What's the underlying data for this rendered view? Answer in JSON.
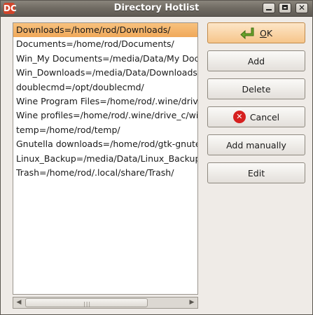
{
  "window": {
    "title": "Directory Hotlist",
    "app_icon_glyph": "DC",
    "controls": {
      "minimize": "minimize-icon",
      "maximize": "maximize-icon",
      "close": "close-icon"
    }
  },
  "hotlist": {
    "items": [
      "Downloads=/home/rod/Downloads/",
      "Documents=/home/rod/Documents/",
      "Win_My Documents=/media/Data/My Documents/",
      "Win_Downloads=/media/Data/Downloads/",
      "doublecmd=/opt/doublecmd/",
      "Wine Program Files=/home/rod/.wine/drive_c/Program Files/",
      "Wine profiles=/home/rod/.wine/drive_c/windows/profiles/",
      "temp=/home/rod/temp/",
      "Gnutella downloads=/home/rod/gtk-gnutella-downloads/",
      "Linux_Backup=/media/Data/Linux_Backup/",
      "Trash=/home/rod/.local/share/Trash/"
    ],
    "selected_index": 0
  },
  "buttons": {
    "ok_first": "O",
    "ok_rest": "K",
    "add": "Add",
    "delete": "Delete",
    "cancel": "Cancel",
    "add_manually": "Add manually",
    "edit": "Edit"
  },
  "colors": {
    "selection": "#f0a85a",
    "ok_arrow": "#6aa329",
    "cancel_red": "#d6201f"
  }
}
